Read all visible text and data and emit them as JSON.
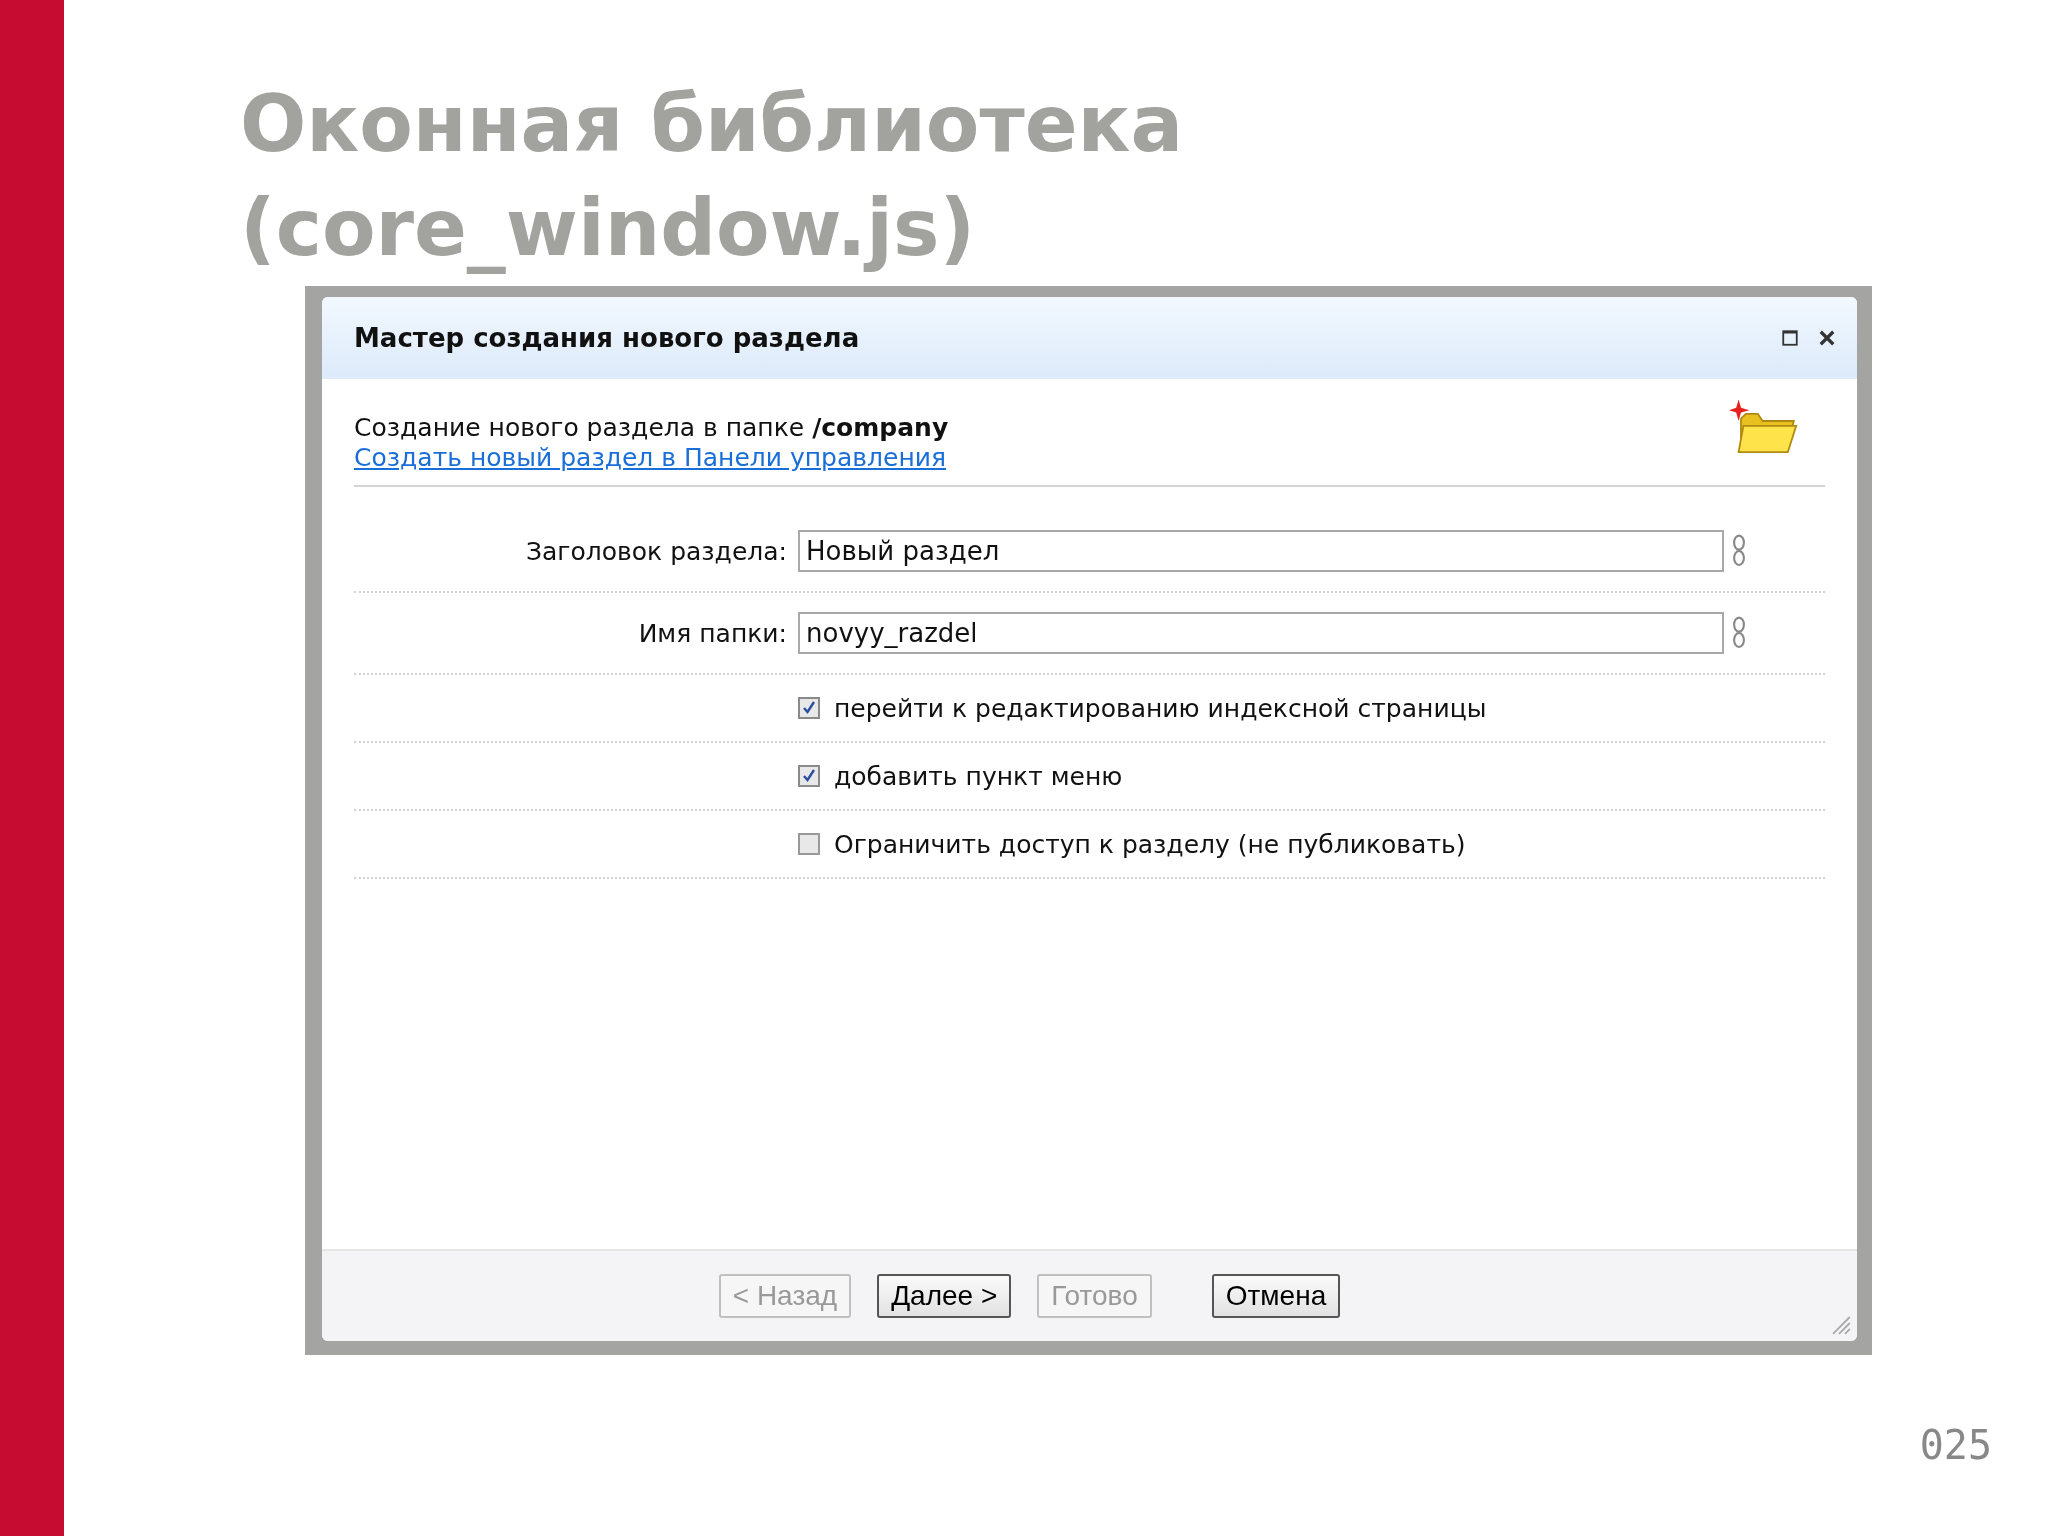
{
  "slide": {
    "title_lines": [
      "Оконная библиотека",
      "(core_window.js)"
    ],
    "page_number": "025"
  },
  "dialog": {
    "title": "Мастер создания нового раздела",
    "intro": "Создание нового раздела в папке **/company**",
    "link": "Создать новый раздел в Панели управления",
    "fields": [
      {
        "label": "Заголовок раздела:",
        "value": "Новый раздел"
      },
      {
        "label": "Имя папки:",
        "value": "novyy_razdel"
      }
    ],
    "options": [
      {
        "label": "перейти к редактированию индексной страницы",
        "checked": true
      },
      {
        "label": "добавить пункт меню",
        "checked": true
      },
      {
        "label": "Ограничить доступ к разделу (не публиковать)",
        "checked": false
      }
    ],
    "buttons": [
      {
        "label": "< Назад",
        "disabled": true
      },
      {
        "label": "Далее >",
        "disabled": false
      },
      {
        "label": "Готово",
        "disabled": true
      },
      {
        "label": "Отмена",
        "disabled": false
      }
    ]
  }
}
